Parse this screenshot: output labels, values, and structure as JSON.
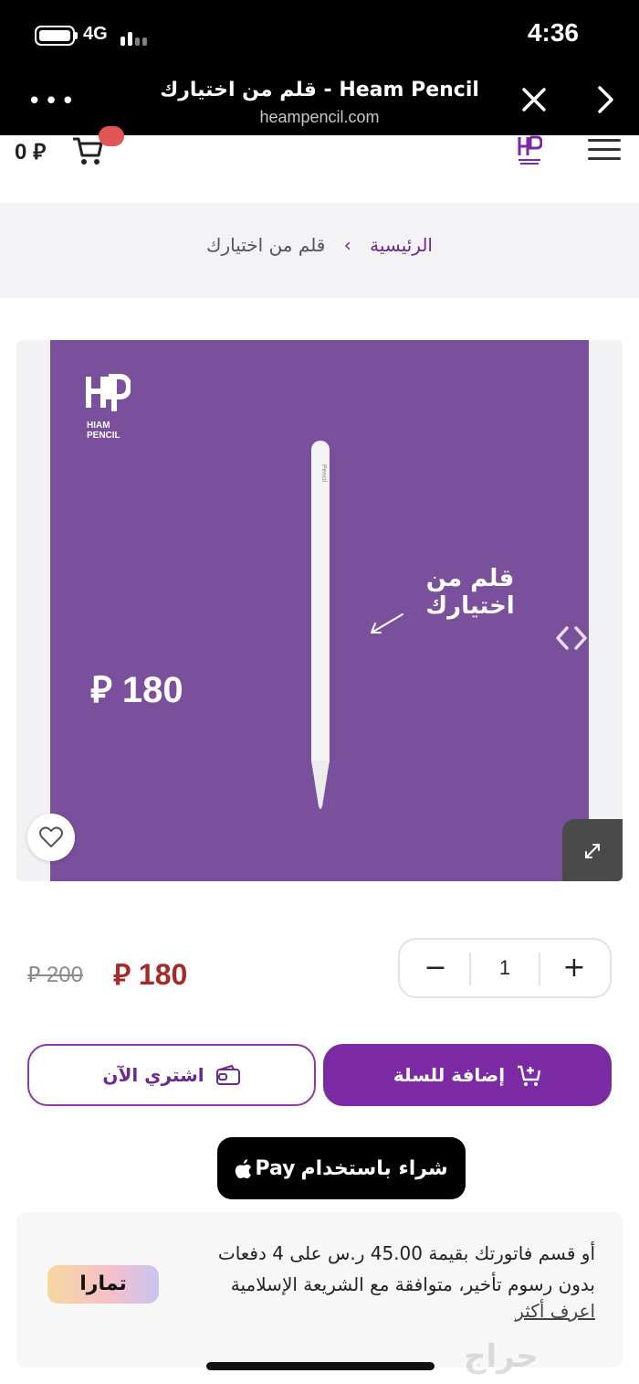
{
  "status_bar": {
    "network": "4G",
    "time": "4:36"
  },
  "browser": {
    "title": "قلم من اختيارك - Heam Pencil",
    "url": "heampencil.com",
    "more_label": "•••"
  },
  "header": {
    "cart_total": "0 ⃁"
  },
  "breadcrumb": {
    "home": "الرئيسية",
    "separator": "›",
    "current": "قلم من اختيارك"
  },
  "product_image": {
    "brand": "HIAM\nPENCIL",
    "headline": "قلم من اختيارك",
    "price_tag": "⃁ 180",
    "pencil_text": "Pencil"
  },
  "pricing": {
    "old_price": "⃁ 200",
    "new_price": "⃁ 180"
  },
  "quantity": {
    "minus": "−",
    "value": "1",
    "plus": "+"
  },
  "actions": {
    "add_to_cart": "إضافة  للسلة",
    "buy_now": "اشتري الآن"
  },
  "apple_pay": {
    "label": "شراء باستخدام",
    "brand": "Pay"
  },
  "tamara": {
    "line1_prefix": "أو قسم فاتورتك بقيمة",
    "amount": "45.00",
    "line1_suffix": "ر.س على 4 دفعات",
    "line2": "بدون رسوم تأخير، متوافقة مع الشريعة الإسلامية",
    "learn_more": "اعرف أكثر",
    "logo": "تمارا"
  },
  "watermark": "حراج",
  "colors": {
    "brand_purple": "#7b2aa4",
    "image_bg": "#7a4f9b",
    "sale_red": "#a52a2a"
  }
}
